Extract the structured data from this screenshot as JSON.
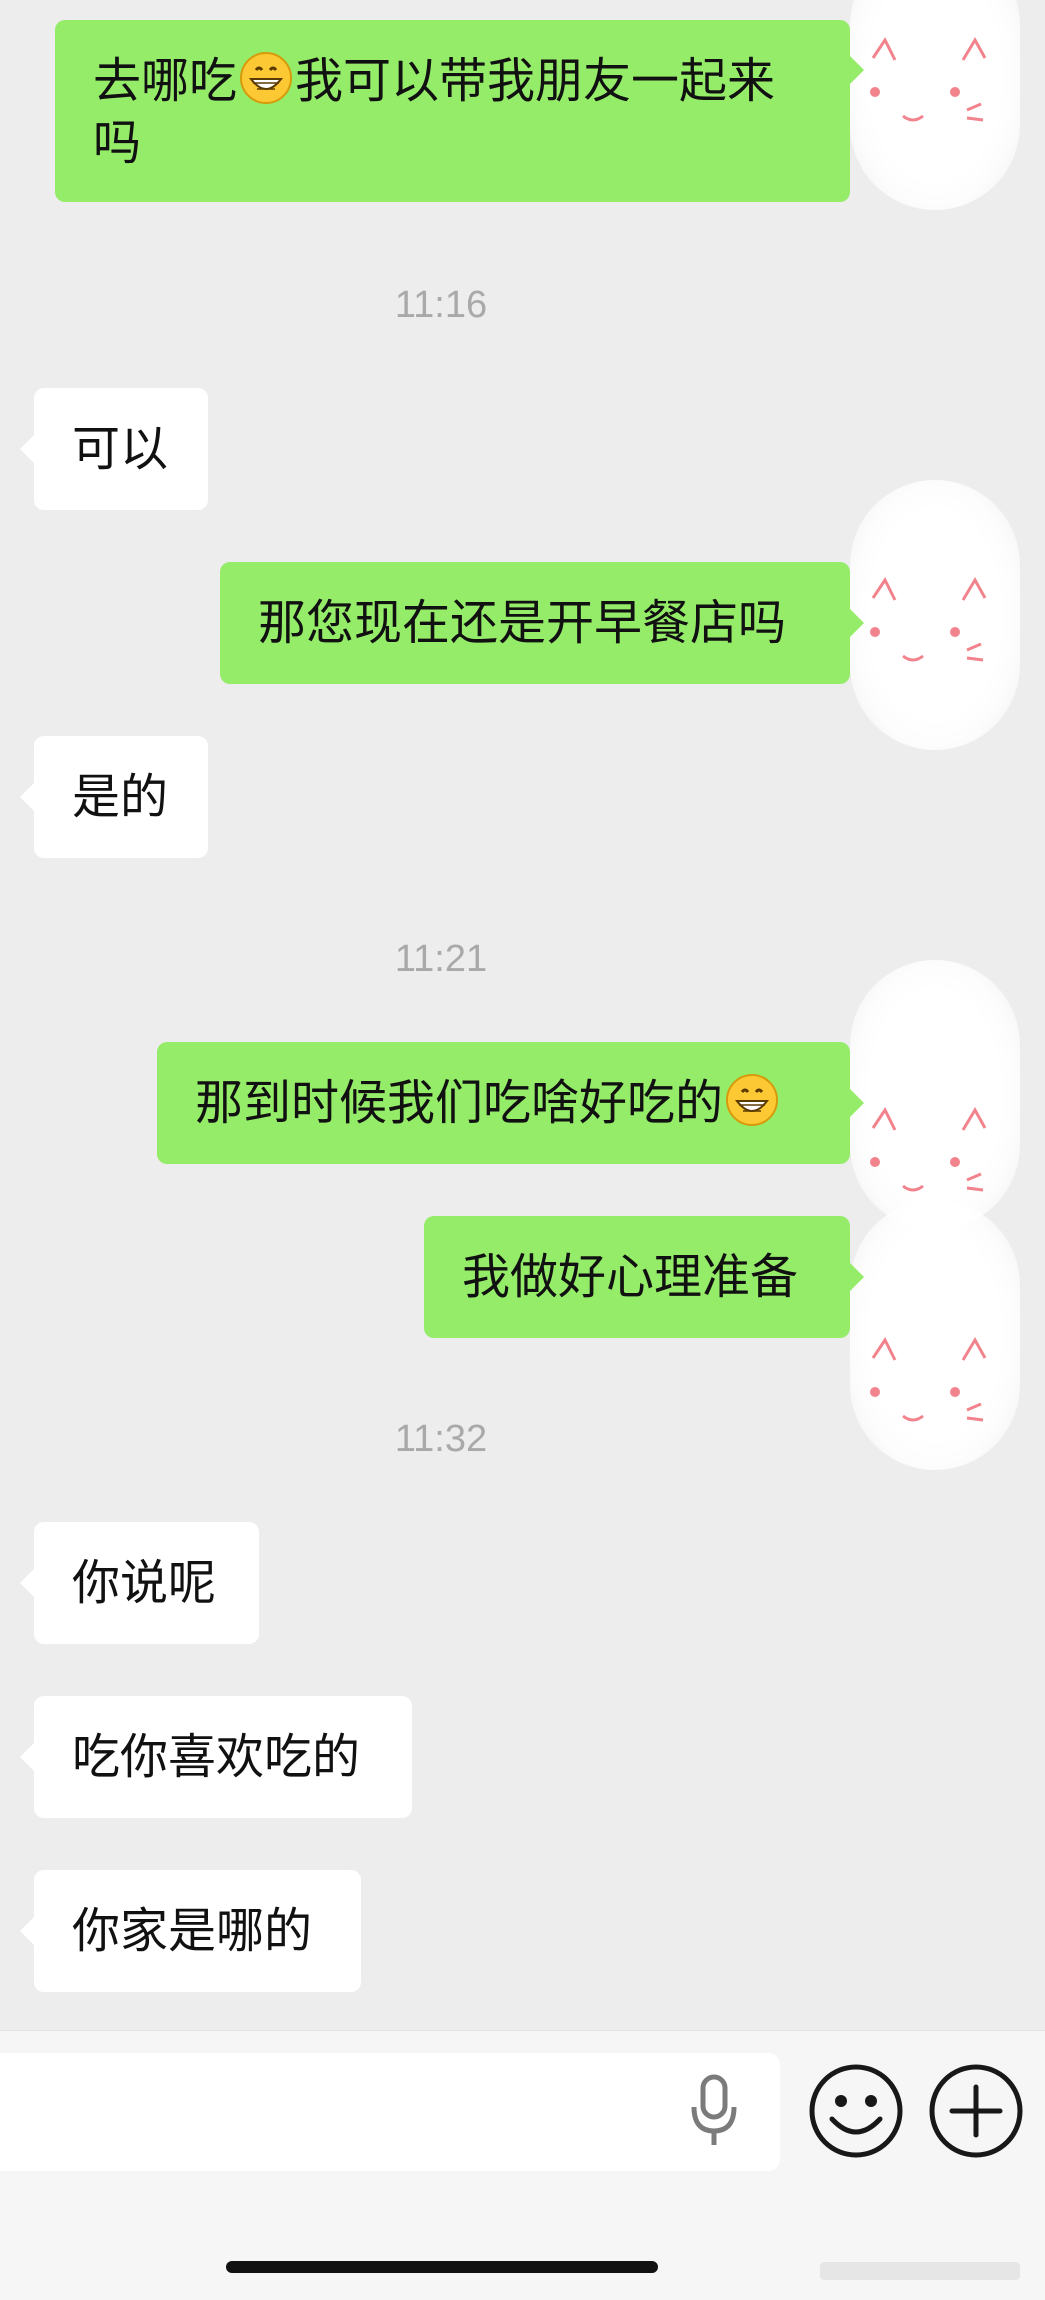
{
  "chat": {
    "messages": [
      {
        "id": "m1",
        "direction": "out",
        "text_before": "去哪吃",
        "emoji": "grinning-face",
        "text_after": "我可以带我朋友一起来",
        "text_line2": "吗"
      },
      {
        "id": "m2",
        "direction": "in",
        "text": "可以"
      },
      {
        "id": "m3",
        "direction": "out",
        "text": "那您现在还是开早餐店吗"
      },
      {
        "id": "m4",
        "direction": "in",
        "text": "是的"
      },
      {
        "id": "m5",
        "direction": "out",
        "text": "那到时候我们吃啥好吃的",
        "emoji": "grinning-face"
      },
      {
        "id": "m6",
        "direction": "out",
        "text": "我做好心理准备"
      },
      {
        "id": "m7",
        "direction": "in",
        "text": "你说呢"
      },
      {
        "id": "m8",
        "direction": "in",
        "text": "吃你喜欢吃的"
      },
      {
        "id": "m9",
        "direction": "in",
        "text": "你家是哪的"
      }
    ],
    "timestamps": [
      "11:16",
      "11:21",
      "11:32"
    ]
  },
  "input_bar": {
    "icons": [
      "microphone-icon",
      "emoji-icon",
      "plus-icon"
    ]
  },
  "colors": {
    "background": "#ededed",
    "outgoing_bubble": "#95ec69",
    "incoming_bubble": "#ffffff",
    "timestamp_text": "#a9a9a9",
    "avatar_accent": "#f2838d"
  }
}
